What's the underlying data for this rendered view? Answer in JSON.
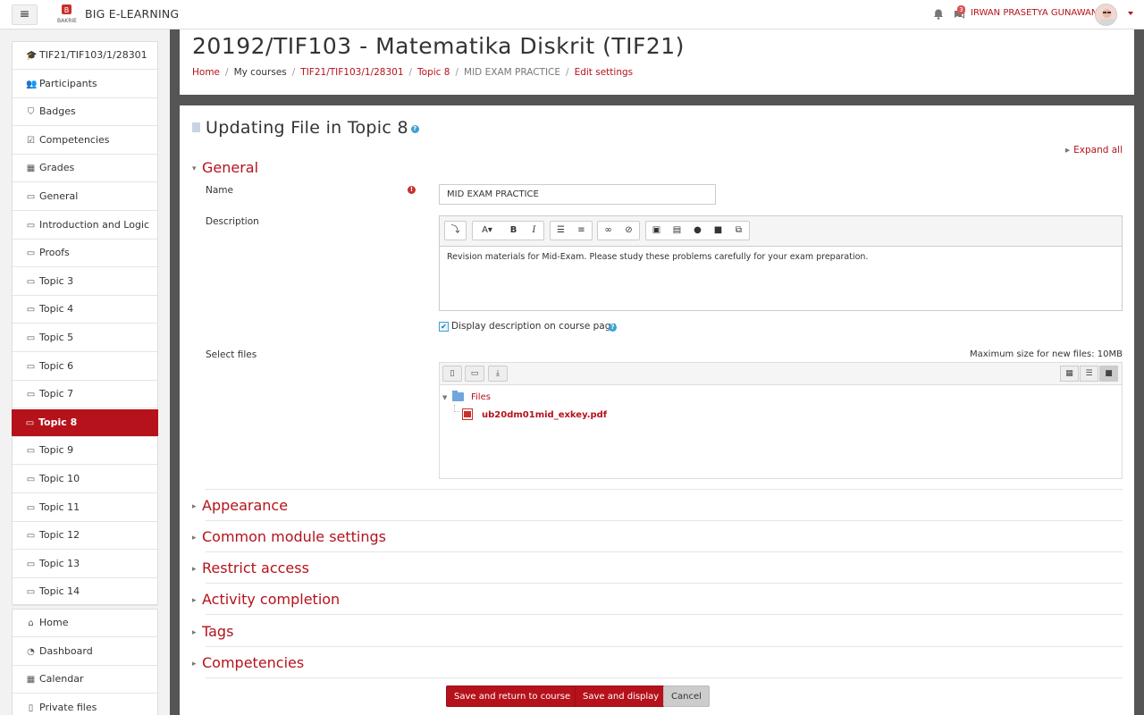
{
  "navbar": {
    "brand": "BIG E-LEARNING",
    "menu_icon": "hamburger-icon",
    "notification_count": "3",
    "username": "IRWAN PRASETYA GUNAWAN"
  },
  "sidebar": {
    "items": [
      {
        "label": "TIF21/TIF103/1/28301",
        "icon": "graduation-cap-icon",
        "glyph": "🎓"
      },
      {
        "label": "Participants",
        "icon": "users-icon",
        "glyph": "👥"
      },
      {
        "label": "Badges",
        "icon": "shield-icon",
        "glyph": "⛉"
      },
      {
        "label": "Competencies",
        "icon": "checkbox-icon",
        "glyph": "☑"
      },
      {
        "label": "Grades",
        "icon": "table-icon",
        "glyph": "▦"
      },
      {
        "label": "General",
        "icon": "folder-icon",
        "glyph": "▭"
      },
      {
        "label": "Introduction and Logic",
        "icon": "folder-icon",
        "glyph": "▭"
      },
      {
        "label": "Proofs",
        "icon": "folder-icon",
        "glyph": "▭"
      },
      {
        "label": "Topic 3",
        "icon": "folder-icon",
        "glyph": "▭"
      },
      {
        "label": "Topic 4",
        "icon": "folder-icon",
        "glyph": "▭"
      },
      {
        "label": "Topic 5",
        "icon": "folder-icon",
        "glyph": "▭"
      },
      {
        "label": "Topic 6",
        "icon": "folder-icon",
        "glyph": "▭"
      },
      {
        "label": "Topic 7",
        "icon": "folder-icon",
        "glyph": "▭"
      },
      {
        "label": "Topic 8",
        "icon": "folder-icon",
        "glyph": "▭",
        "active": true
      },
      {
        "label": "Topic 9",
        "icon": "folder-icon",
        "glyph": "▭"
      },
      {
        "label": "Topic 10",
        "icon": "folder-icon",
        "glyph": "▭"
      },
      {
        "label": "Topic 11",
        "icon": "folder-icon",
        "glyph": "▭"
      },
      {
        "label": "Topic 12",
        "icon": "folder-icon",
        "glyph": "▭"
      },
      {
        "label": "Topic 13",
        "icon": "folder-icon",
        "glyph": "▭"
      },
      {
        "label": "Topic 14",
        "icon": "folder-icon",
        "glyph": "▭"
      }
    ],
    "global_items": [
      {
        "label": "Home",
        "icon": "home-icon",
        "glyph": "⌂"
      },
      {
        "label": "Dashboard",
        "icon": "dashboard-icon",
        "glyph": "◔"
      },
      {
        "label": "Calendar",
        "icon": "calendar-icon",
        "glyph": "▦"
      },
      {
        "label": "Private files",
        "icon": "file-icon",
        "glyph": "▯"
      }
    ]
  },
  "header": {
    "title": "20192/TIF103 - Matematika Diskrit (TIF21)",
    "breadcrumb": {
      "home": "Home",
      "my_courses": "My courses",
      "course": "TIF21/TIF103/1/28301",
      "topic": "Topic 8",
      "resource": "MID EXAM PRACTICE",
      "current": "Edit settings"
    }
  },
  "form": {
    "title": "Updating File in Topic 8",
    "expand_all": "Expand all",
    "general": {
      "heading": "General",
      "name_label": "Name",
      "name_value": "MID EXAM PRACTICE",
      "description_label": "Description",
      "description_value": "Revision materials for Mid-Exam. Please study these problems carefully for your exam preparation.",
      "display_description_label": "Display description on course page",
      "display_description_checked": true,
      "select_files_label": "Select files",
      "max_size": "Maximum size for new files: 10MB",
      "files_root": "Files",
      "file_name": "ub20dm01mid_exkey.pdf"
    },
    "sections": [
      "Appearance",
      "Common module settings",
      "Restrict access",
      "Activity completion",
      "Tags",
      "Competencies"
    ],
    "buttons": {
      "save_return": "Save and return to course",
      "save_display": "Save and display",
      "cancel": "Cancel"
    }
  },
  "colors": {
    "accent": "#b5121b",
    "gutter": "#555555",
    "sidebar_bg": "#f2f2f2"
  }
}
